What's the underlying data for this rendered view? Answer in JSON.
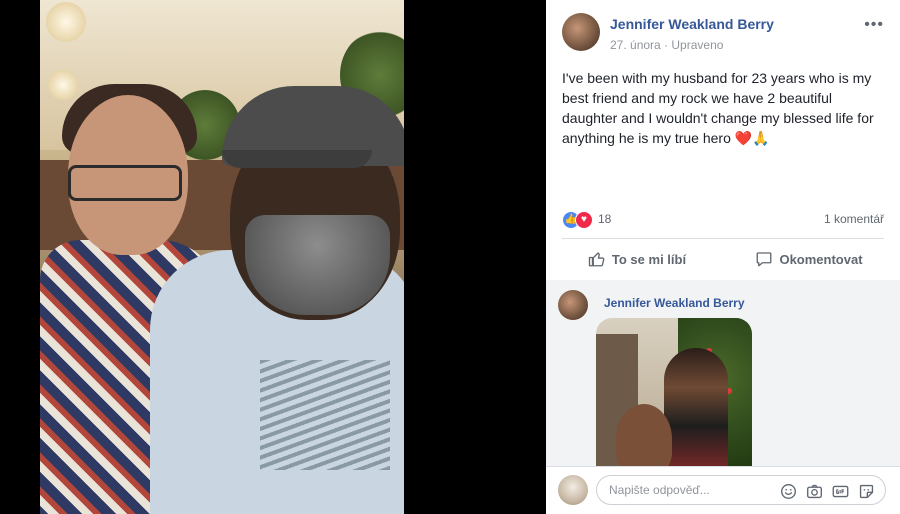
{
  "post": {
    "author": "Jennifer Weakland Berry",
    "date": "27. února",
    "separator": " · ",
    "edited": "Upraveno",
    "more": "•••",
    "text_main": "I've been with my husband for 23 years who is my best friend and my rock we have 2 beautiful daughter and I wouldn't change my blessed life for anything he is my true hero ",
    "text_emoji": "❤️🙏"
  },
  "reactions": {
    "count": "18",
    "comments": "1 komentář",
    "like_icon": "👍",
    "love_icon": "♥",
    "types": [
      "like-icon",
      "love-icon"
    ]
  },
  "actions": {
    "like_label": "To se mi líbí",
    "comment_label": "Okomentovat"
  },
  "comment": {
    "author": "Jennifer Weakland Berry"
  },
  "composer": {
    "placeholder": "Napište odpověď..."
  },
  "colors": {
    "link_blue": "#365899",
    "like_blue": "#4b88f7",
    "love_red": "#f0284a",
    "muted": "#90949c"
  }
}
